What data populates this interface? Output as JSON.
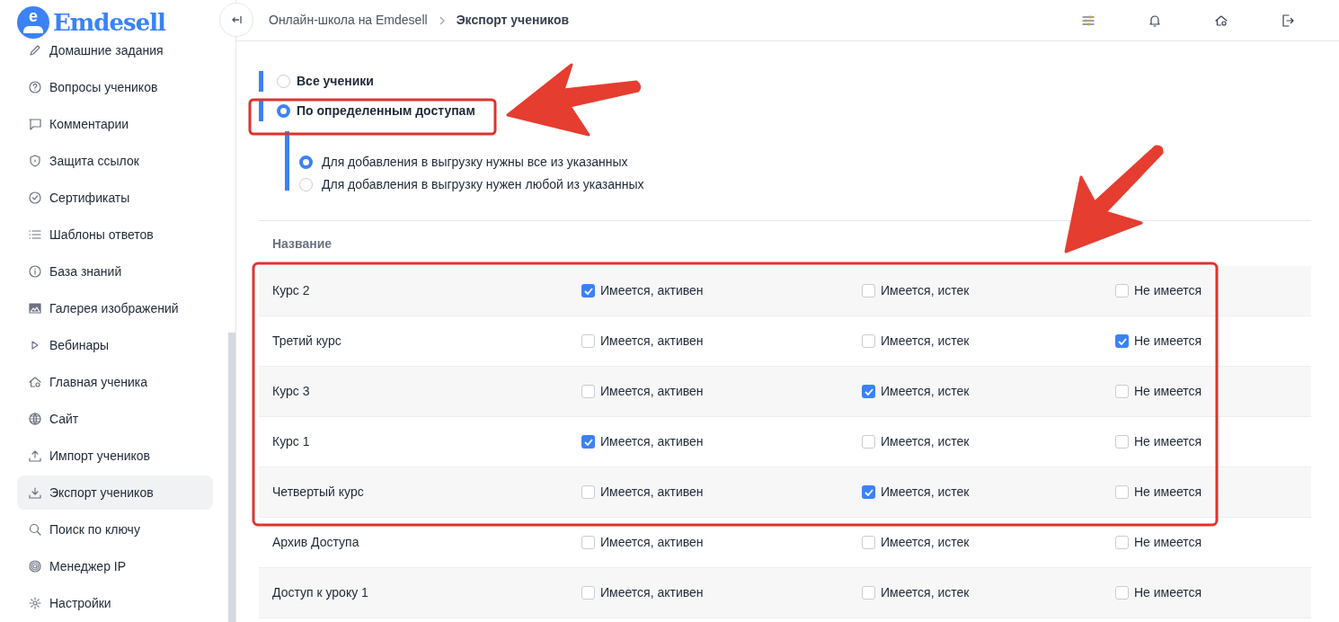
{
  "logo": {
    "mark": "e",
    "text": "Emdesell"
  },
  "sidebar": {
    "items": [
      {
        "label": "Домашние задания",
        "kind": "pencil",
        "selected": false
      },
      {
        "label": "Вопросы учеников",
        "kind": "question",
        "selected": false
      },
      {
        "label": "Комментарии",
        "kind": "comment",
        "selected": false
      },
      {
        "label": "Защита ссылок",
        "kind": "shield",
        "selected": false
      },
      {
        "label": "Сертификаты",
        "kind": "check-circle",
        "selected": false
      },
      {
        "label": "Шаблоны ответов",
        "kind": "list",
        "selected": false
      },
      {
        "label": "База знаний",
        "kind": "info",
        "selected": false
      },
      {
        "label": "Галерея изображений",
        "kind": "image",
        "selected": false
      },
      {
        "label": "Вебинары",
        "kind": "play",
        "selected": false
      },
      {
        "label": "Главная ученика",
        "kind": "home",
        "selected": false
      },
      {
        "label": "Сайт",
        "kind": "globe",
        "selected": false
      },
      {
        "label": "Импорт учеников",
        "kind": "upload",
        "selected": false
      },
      {
        "label": "Экспорт учеников",
        "kind": "download",
        "selected": true
      },
      {
        "label": "Поиск по ключу",
        "kind": "search",
        "selected": false
      },
      {
        "label": "Менеджер IP",
        "kind": "target",
        "selected": false
      },
      {
        "label": "Настройки",
        "kind": "gear",
        "selected": false
      }
    ]
  },
  "breadcrumb": [
    {
      "label": "Онлайн-школа на Emdesell",
      "current": false
    },
    {
      "label": "Экспорт учеников",
      "current": true
    }
  ],
  "header_icons": [
    {
      "kind": "sliders"
    },
    {
      "kind": "bell"
    },
    {
      "kind": "home"
    },
    {
      "kind": "logout"
    }
  ],
  "scope_options": [
    {
      "label": "Все ученики",
      "selected": false
    },
    {
      "label": "По определенным доступам",
      "selected": true
    }
  ],
  "match_options": [
    {
      "label": "Для добавления в выгрузку нужны все из указанных",
      "selected": true
    },
    {
      "label": "Для добавления в выгрузку нужен любой из указанных",
      "selected": false
    }
  ],
  "table": {
    "columns": [
      "Название"
    ],
    "rows": [
      {
        "name": "Курс 2",
        "options": [
          {
            "label": "Имеется, активен",
            "checked": true
          },
          {
            "label": "Имеется, истек",
            "checked": false
          },
          {
            "label": "Не имеется",
            "checked": false
          }
        ]
      },
      {
        "name": "Третий курс",
        "options": [
          {
            "label": "Имеется, активен",
            "checked": false
          },
          {
            "label": "Имеется, истек",
            "checked": false
          },
          {
            "label": "Не имеется",
            "checked": true
          }
        ]
      },
      {
        "name": "Курс 3",
        "options": [
          {
            "label": "Имеется, активен",
            "checked": false
          },
          {
            "label": "Имеется, истек",
            "checked": true
          },
          {
            "label": "Не имеется",
            "checked": false
          }
        ]
      },
      {
        "name": "Курс 1",
        "options": [
          {
            "label": "Имеется, активен",
            "checked": true
          },
          {
            "label": "Имеется, истек",
            "checked": false
          },
          {
            "label": "Не имеется",
            "checked": false
          }
        ]
      },
      {
        "name": "Четвертый курс",
        "options": [
          {
            "label": "Имеется, активен",
            "checked": false
          },
          {
            "label": "Имеется, истек",
            "checked": true
          },
          {
            "label": "Не имеется",
            "checked": false
          }
        ]
      },
      {
        "name": "Архив Доступа",
        "options": [
          {
            "label": "Имеется, активен",
            "checked": false
          },
          {
            "label": "Имеется, истек",
            "checked": false
          },
          {
            "label": "Не имеется",
            "checked": false
          }
        ]
      },
      {
        "name": "Доступ к уроку 1",
        "options": [
          {
            "label": "Имеется, активен",
            "checked": false
          },
          {
            "label": "Имеется, истек",
            "checked": false
          },
          {
            "label": "Не имеется",
            "checked": false
          }
        ]
      }
    ]
  }
}
